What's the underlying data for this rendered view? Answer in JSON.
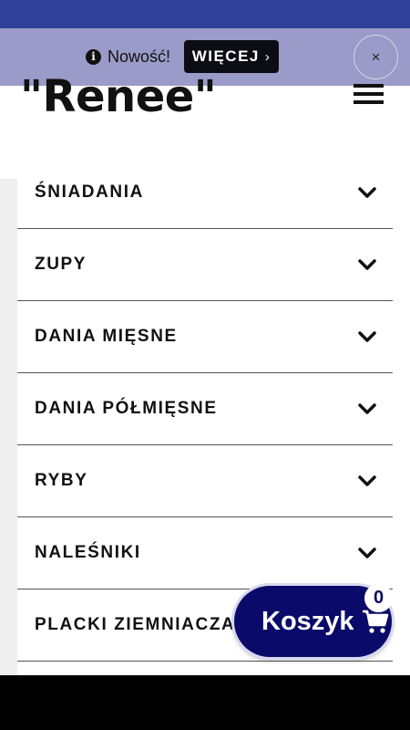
{
  "notice": {
    "text": "Nowość!",
    "more_label": "WIĘCEJ",
    "more_chevron": "›",
    "close_symbol": "×",
    "info_symbol": "i"
  },
  "brand": {
    "logo_text": "\"Renee\""
  },
  "menu": {
    "items": [
      {
        "label": "ŚNIADANIA",
        "icon": "chevron-down-icon"
      },
      {
        "label": "ZUPY",
        "icon": "chevron-down-icon"
      },
      {
        "label": "DANIA MIĘSNE",
        "icon": "chevron-down-icon"
      },
      {
        "label": "DANIA PÓŁMIĘSNE",
        "icon": "chevron-down-icon"
      },
      {
        "label": "RYBY",
        "icon": "chevron-down-icon"
      },
      {
        "label": "NALEŚNIKI",
        "icon": "chevron-down-icon"
      },
      {
        "label": "PLACKI ZIEMNIACZANE",
        "icon": "chevron-down-icon"
      }
    ]
  },
  "cart": {
    "label": "Koszyk",
    "count": "0",
    "icon": "shopping-cart-icon"
  },
  "colors": {
    "top_strip": "#2f3f9a",
    "notice_bg": "#9a9bc8",
    "cart_bg": "#0a0a6a"
  }
}
